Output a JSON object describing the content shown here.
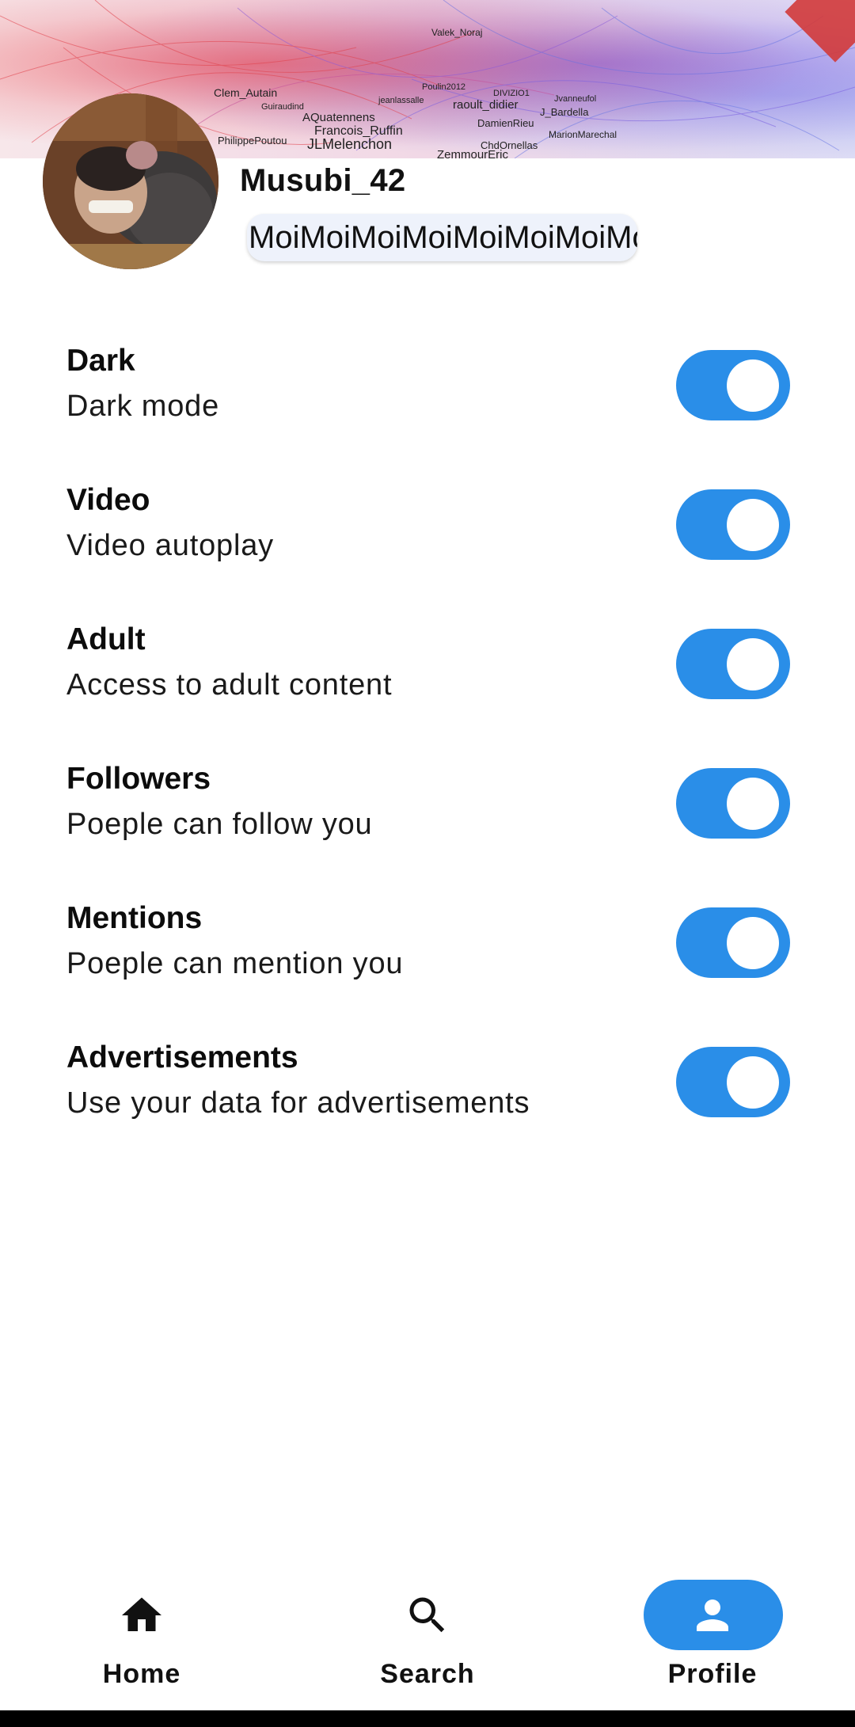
{
  "banner": {
    "graph_labels": [
      "Valek_Noraj",
      "Clem_Autain",
      "Guiraudind",
      "AQuatennens",
      "Francois_Ruffin",
      "JLMelenchon",
      "PhilippePoutou",
      "raoult_didier",
      "DamienRieu",
      "J_Bardella",
      "MarionMarechal",
      "ChdOrnellas",
      "ZemmourEric",
      "Poulin2012",
      "jeanlassalle",
      "Jvanneufol",
      "DIVIZIO1"
    ]
  },
  "profile": {
    "username": "Musubi_42",
    "bio": "MoiMoiMoiMoiMoiMoiMoiMoi"
  },
  "settings": [
    {
      "title": "Dark",
      "subtitle": "Dark mode",
      "enabled": true
    },
    {
      "title": "Video",
      "subtitle": "Video autoplay",
      "enabled": true
    },
    {
      "title": "Adult",
      "subtitle": "Access to adult content",
      "enabled": true
    },
    {
      "title": "Followers",
      "subtitle": "Poeple can follow you",
      "enabled": true
    },
    {
      "title": "Mentions",
      "subtitle": "Poeple can mention you",
      "enabled": true
    },
    {
      "title": "Advertisements",
      "subtitle": "Use your data for advertisements",
      "enabled": true
    }
  ],
  "nav": {
    "home_label": "Home",
    "search_label": "Search",
    "profile_label": "Profile",
    "home_icon": "home-icon",
    "search_icon": "search-icon",
    "profile_icon": "person-icon",
    "active": "profile"
  },
  "colors": {
    "accent": "#2a8ee8",
    "toggle_knob": "#ffffff",
    "bio_chip": "#eef2fb"
  }
}
